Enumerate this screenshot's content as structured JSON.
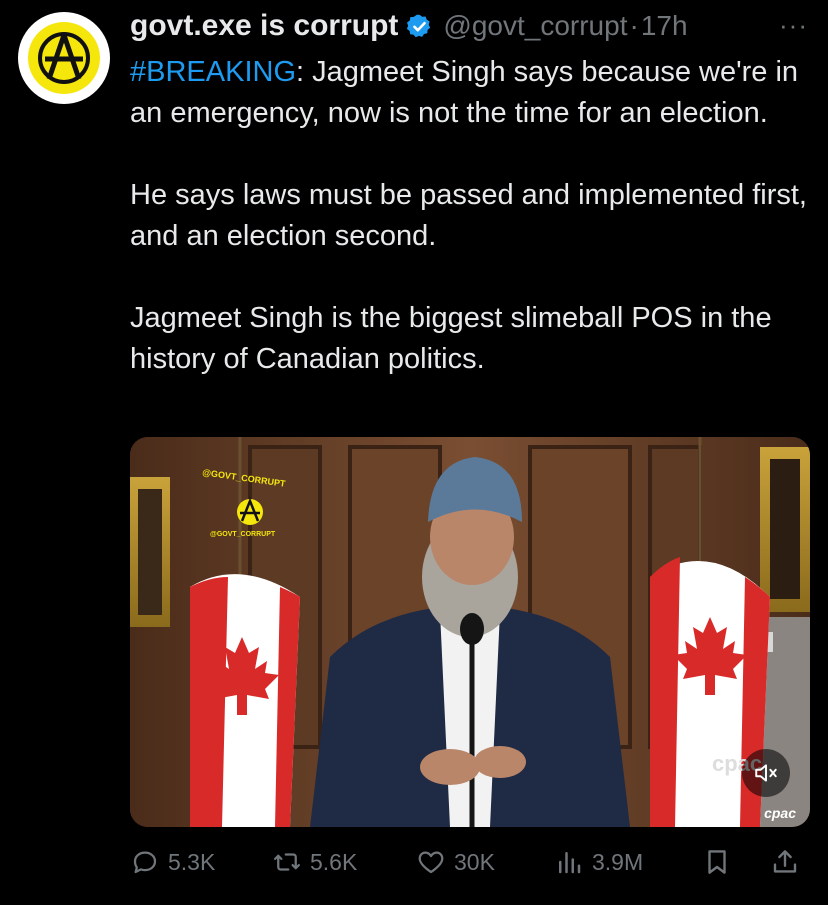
{
  "tweet": {
    "author_name": "govt.exe is corrupt",
    "handle": "@govt_corrupt",
    "separator": "·",
    "time": "17h",
    "more": "···",
    "hashtag": "#BREAKING",
    "line1_rest": ": Jagmeet Singh says because we're in an emergency, now is not the time for an election.",
    "paragraph2": "He says laws must be passed and implemented first, and an election second.",
    "paragraph3": "Jagmeet Singh is the biggest slimeball POS in the history of Canadian politics."
  },
  "media": {
    "watermark_top": "@GOVT_CORRUPT",
    "watermark_bottom": "@GOVT_CORRUPT",
    "broadcaster": "cpac",
    "broadcaster_small": "cpac"
  },
  "actions": {
    "replies": "5.3K",
    "reposts": "5.6K",
    "likes": "30K",
    "views": "3.9M"
  },
  "icons": {
    "verified": "verified-badge-icon",
    "reply": "reply-icon",
    "repost": "repost-icon",
    "like": "heart-icon",
    "views": "views-icon",
    "bookmark": "bookmark-icon",
    "share": "share-icon",
    "mute": "mute-icon"
  },
  "colors": {
    "background": "#000000",
    "text": "#e7e9ea",
    "muted": "#71767b",
    "link": "#1d9bf0",
    "avatar_yellow": "#f5e60c"
  }
}
